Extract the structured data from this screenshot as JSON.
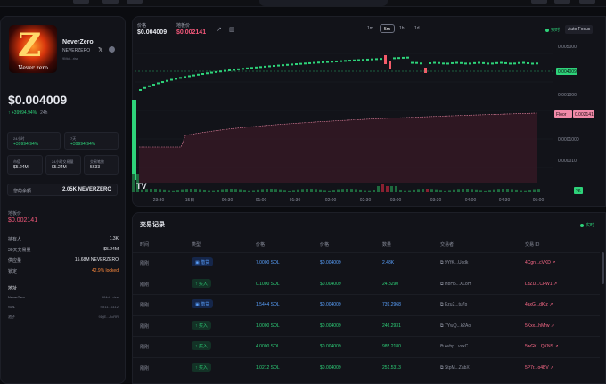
{
  "token": {
    "name": "NeverZero",
    "symbol": "NEVERZERO",
    "address_short": "9Mcl...rise",
    "image_caption": "Never zero",
    "price": "$0.004009",
    "change": "+39994.94%",
    "change_period": "24h",
    "stats": [
      {
        "label": "24小时",
        "value": "+39994.94%"
      },
      {
        "label": "7天",
        "value": "+39994.94%"
      }
    ],
    "stats2": [
      {
        "label": "市值",
        "value": "$5.24M"
      },
      {
        "label": "24小时交易量",
        "value": "$5.24M"
      },
      {
        "label": "交易笔数",
        "value": "5633"
      }
    ],
    "balance_label": "您的余额",
    "balance_value": "2.05K NEVERZERO",
    "floor_label": "地板价",
    "floor_value": "$0.002141",
    "info": [
      {
        "k": "持有人",
        "v": "1.3K"
      },
      {
        "k": "30天交易量",
        "v": "$5.24M"
      },
      {
        "k": "供应量",
        "v": "15.68M NEVERZERO"
      },
      {
        "k": "锁定",
        "v": "42.9% locked"
      }
    ],
    "address_title": "地址",
    "addresses": [
      {
        "k": "NeverZero",
        "v": "9Mcl...rise"
      },
      {
        "k": "SOL",
        "v": "So11...1112"
      },
      {
        "k": "池子",
        "v": "9DjE...AcRR"
      }
    ]
  },
  "chart_header": {
    "price_label": "价格",
    "price_value": "$0.004009",
    "floor_label": "地板价",
    "floor_value": "$0.002141",
    "timeframes": [
      "1m",
      "5m",
      "1h",
      "1d"
    ],
    "active_timeframe": "5m",
    "live_label": "实时",
    "autofocus_label": "Auto Focus"
  },
  "chart_data": {
    "type": "candlestick",
    "y_axis_ticks": [
      "0.005000",
      "0.001000",
      "0.0001000",
      "0.000010"
    ],
    "current_price_tag": "0.004009",
    "floor_tag_label": "Floor",
    "floor_tag_value": "0.002141",
    "x_ticks": [
      "23:30",
      "15日",
      "00:30",
      "01:00",
      "01:30",
      "02:00",
      "02:30",
      "03:00",
      "03:30",
      "04:00",
      "04:30",
      "05:00"
    ],
    "volume_tag": "26",
    "watermark": "TV",
    "y_scale": "log",
    "colors": {
      "up": "#2ed37a",
      "down": "#f45b69",
      "floor": "#f08aa8"
    }
  },
  "trades": {
    "title": "交易记录",
    "live_label": "实时",
    "columns": [
      "时间",
      "类型",
      "价格",
      "价格",
      "数量",
      "交易者",
      "交易 ID"
    ],
    "rows": [
      {
        "time": "刚刚",
        "type": "借贷",
        "kind": "lend",
        "sol": "7.0000 SOL",
        "price": "$0.004009",
        "qty": "2.48K",
        "trader": "9YfK...Ucdk",
        "tx": "4Cgn...cVKD"
      },
      {
        "time": "刚刚",
        "type": "买入",
        "kind": "buy",
        "sol": "0.1000 SOL",
        "price": "$0.004009",
        "qty": "24.8290",
        "trader": "H8H5...XL8H",
        "tx": "LdZU...CFW1"
      },
      {
        "time": "刚刚",
        "type": "借贷",
        "kind": "lend",
        "sol": "1.5444 SOL",
        "price": "$0.004009",
        "qty": "739.2968",
        "trader": "Ezu2...tu7p",
        "tx": "4axG...dKjz"
      },
      {
        "time": "刚刚",
        "type": "买入",
        "kind": "buy",
        "sol": "1.0000 SOL",
        "price": "$0.004009",
        "qty": "246.2931",
        "trader": "7YwQ...k2Ao",
        "tx": "5Kxx...hMrw"
      },
      {
        "time": "刚刚",
        "type": "买入",
        "kind": "buy",
        "sol": "4.0000 SOL",
        "price": "$0.004009",
        "qty": "985.2180",
        "trader": "Avbp...vxxC",
        "tx": "5wGK...QKNS"
      },
      {
        "time": "刚刚",
        "type": "买入",
        "kind": "buy",
        "sol": "1.0212 SOL",
        "price": "$0.004009",
        "qty": "251.5313",
        "trader": "StpM...ZabX",
        "tx": "5P7r...o4BV"
      }
    ]
  }
}
